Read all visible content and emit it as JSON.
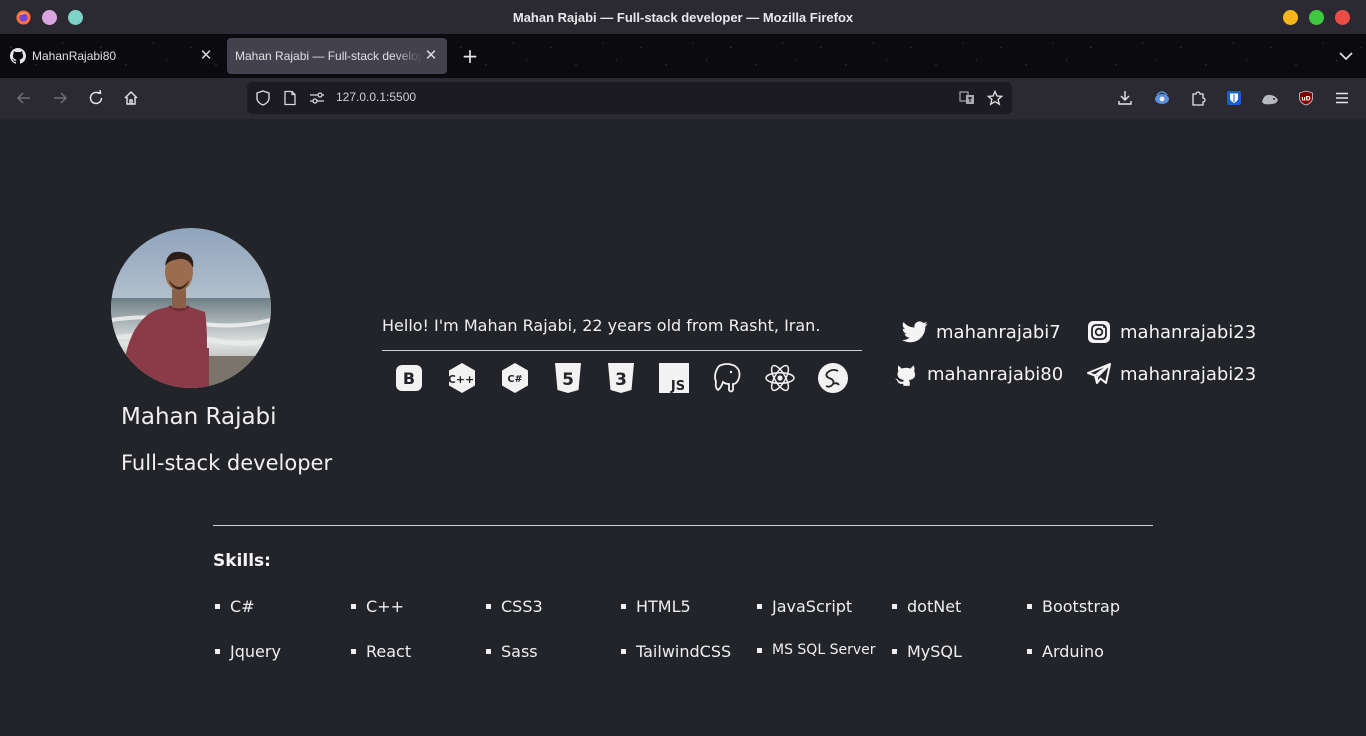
{
  "window": {
    "title": "Mahan Rajabi — Full-stack developer — Mozilla Firefox",
    "left_dot_colors": [
      "#d9a4e0",
      "#7dd3c8"
    ],
    "control_colors": {
      "minimize": "#f5b61b",
      "maximize": "#3fc93e",
      "close": "#ec4b47"
    }
  },
  "tabs": [
    {
      "label": "MahanRajabi80",
      "icon": "github-icon",
      "active": false
    },
    {
      "label": "Mahan Rajabi — Full-stack developer",
      "icon": "",
      "active": true
    }
  ],
  "navbar": {
    "url": "127.0.0.1:5500",
    "toolbar_icons": [
      "download-icon",
      "extension-eye-icon",
      "puzzle-icon",
      "bitwarden-icon",
      "cat-extension-icon",
      "ublock-icon",
      "menu-icon"
    ]
  },
  "profile": {
    "name": "Mahan Rajabi",
    "role": "Full-stack developer",
    "greeting": "Hello! I'm Mahan Rajabi, 22 years old from Rasht, Iran."
  },
  "tech_icons": [
    "bootstrap-icon",
    "cpp-icon",
    "csharp-icon",
    "html5-icon",
    "css3-icon",
    "javascript-icon",
    "postgresql-icon",
    "react-icon",
    "sass-icon"
  ],
  "tech_text": {
    "cpp": "C++",
    "csharp": "C#",
    "html": "5",
    "css": "3",
    "js": "JS",
    "bootstrap": "B"
  },
  "socials": [
    {
      "icon": "twitter-icon",
      "handle": "mahanrajabi7"
    },
    {
      "icon": "instagram-icon",
      "handle": "mahanrajabi23"
    },
    {
      "icon": "github-icon",
      "handle": "mahanrajabi80"
    },
    {
      "icon": "telegram-icon",
      "handle": "mahanrajabi23"
    }
  ],
  "skills": {
    "title": "Skills:",
    "items": [
      "C#",
      "C++",
      "CSS3",
      "HTML5",
      "JavaScript",
      "dotNet",
      "Bootstrap",
      "Jquery",
      "React",
      "Sass",
      "TailwindCSS",
      "MS SQL Server",
      "MySQL",
      "Arduino"
    ]
  },
  "colors": {
    "page_bg": "#222429",
    "chrome_bg": "#2b2a33",
    "url_bg": "#1c1b22",
    "active_tab_bg": "#42414d"
  }
}
